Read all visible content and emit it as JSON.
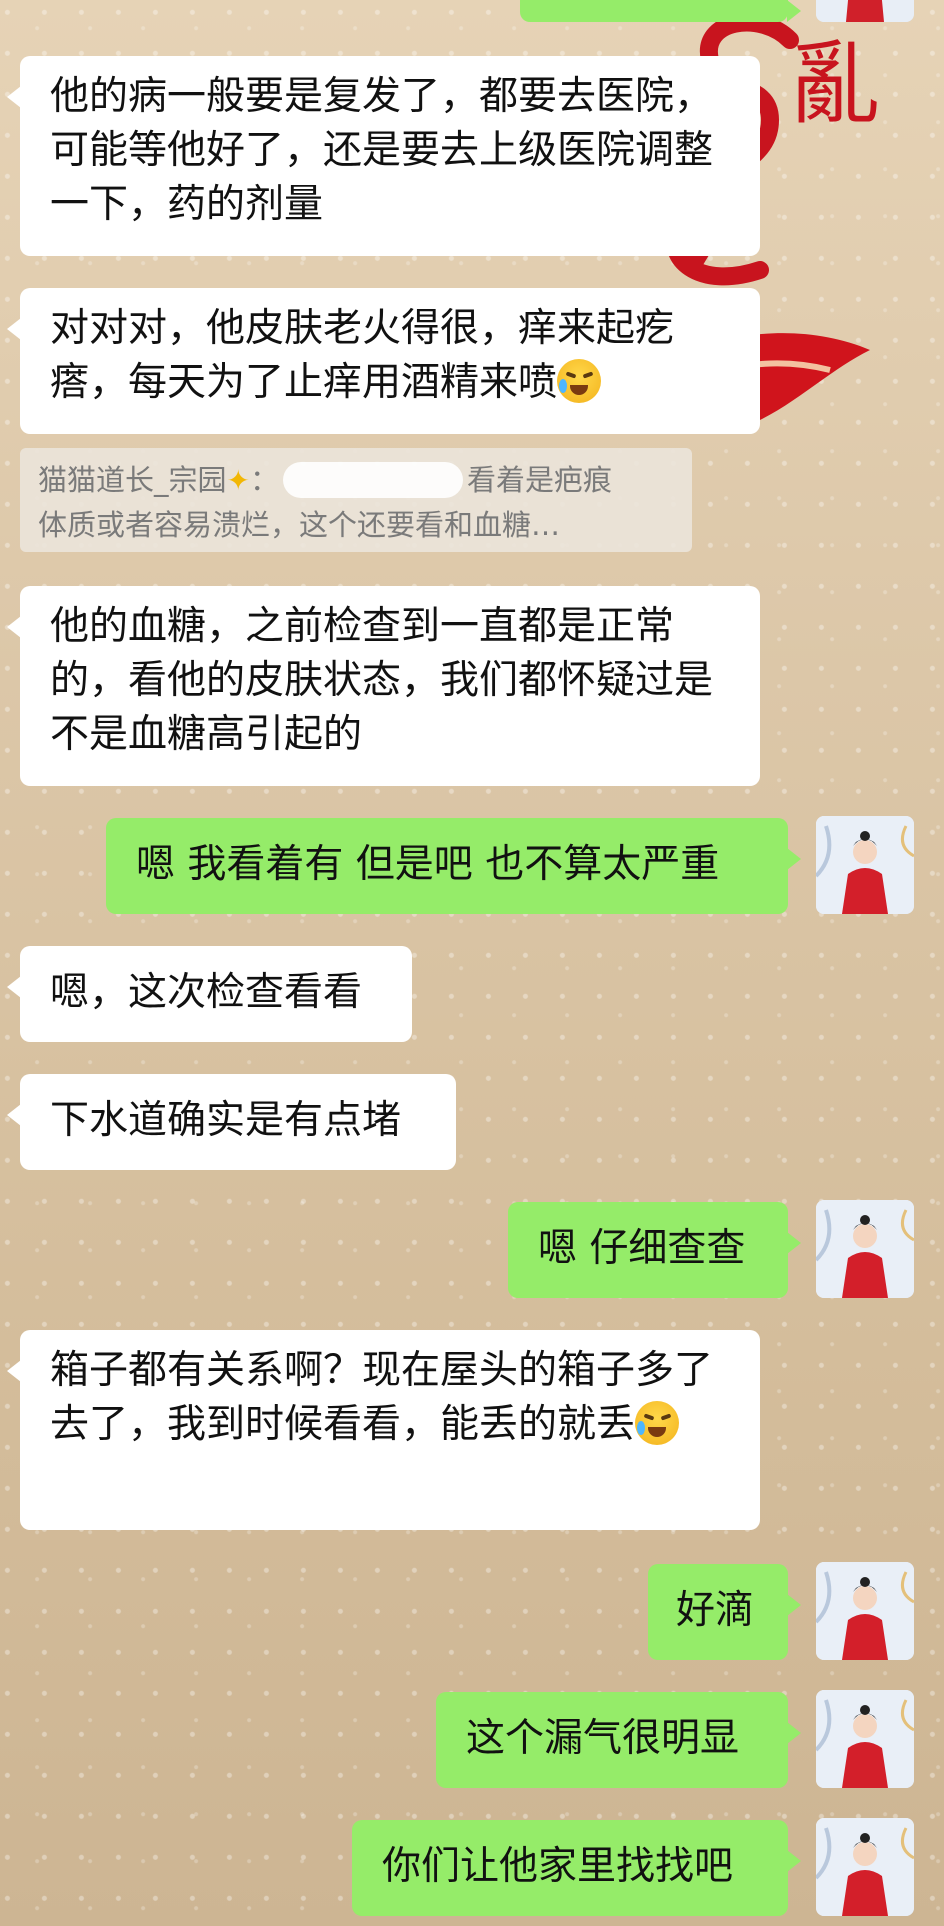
{
  "messages": [
    {
      "side": "left",
      "text": "他的病一般要是复发了，都要去医院，可能等他好了，还是要去上级医院调整一下，药的剂量"
    },
    {
      "side": "left",
      "text": "对对对，他皮肤老火得很，痒来起疙瘩，每天为了止痒用酒精来喷",
      "emoji": "crying-laughing-emoji"
    },
    {
      "side": "left",
      "text": "他的血糖，之前检查到一直都是正常的，看他的皮肤状态，我们都怀疑过是不是血糖高引起的"
    },
    {
      "side": "right",
      "text": "嗯 我看着有 但是吧 也不算太严重"
    },
    {
      "side": "left",
      "text": "嗯，这次检查看看"
    },
    {
      "side": "left",
      "text": "下水道确实是有点堵"
    },
    {
      "side": "right",
      "text": "嗯 仔细查查"
    },
    {
      "side": "left",
      "text": "箱子都有关系啊？现在屋头的箱子多了去了，我到时候看看，能丢的就丢",
      "emoji": "crying-laughing-emoji"
    },
    {
      "side": "right",
      "text": "好滴"
    },
    {
      "side": "right",
      "text": "这个漏气很明显"
    },
    {
      "side": "right",
      "text": "你们让他家里找找吧"
    }
  ],
  "quote": {
    "author": "猫猫道长_宗园",
    "author_icon": "sparkle-star-icon",
    "line1_tail": "看着是疤痕",
    "line2": "体质或者容易溃烂，这个还要看和血糖…"
  },
  "colors": {
    "incoming_bubble": "#ffffff",
    "outgoing_bubble": "#95ec69",
    "background": "#dcc7a8"
  }
}
